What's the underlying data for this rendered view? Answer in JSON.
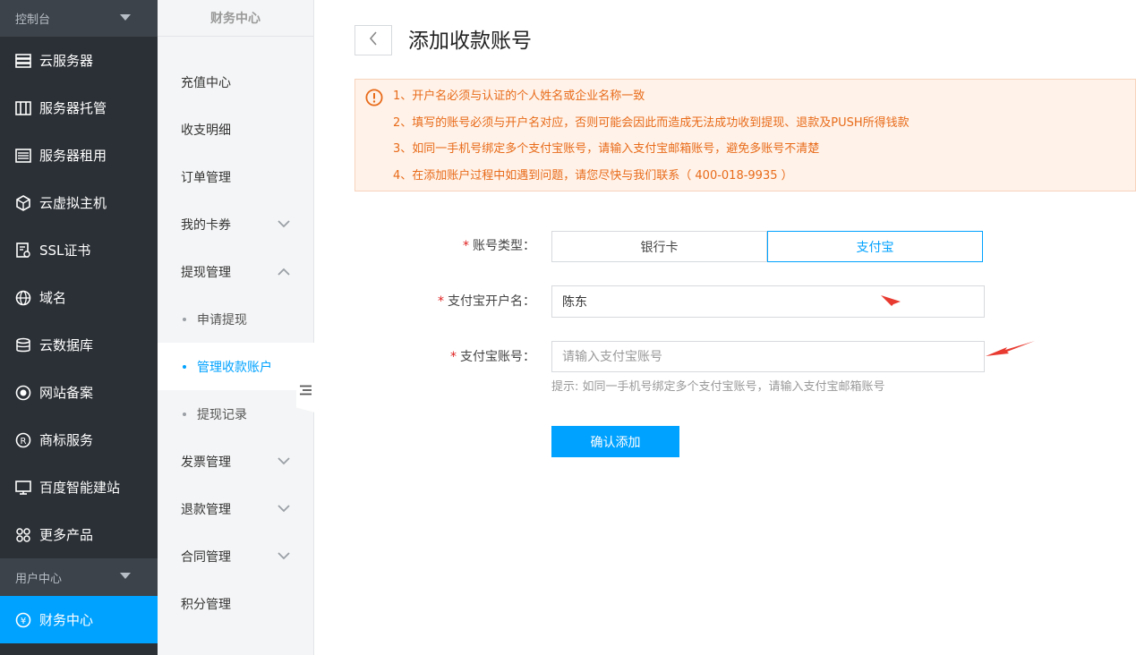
{
  "sidebar": {
    "section_console": "控制台",
    "items": [
      {
        "label": "云服务器",
        "icon": "server-icon"
      },
      {
        "label": "服务器托管",
        "icon": "rack-icon"
      },
      {
        "label": "服务器租用",
        "icon": "list-icon"
      },
      {
        "label": "云虚拟主机",
        "icon": "cube-icon"
      },
      {
        "label": "SSL证书",
        "icon": "certificate-icon"
      },
      {
        "label": "域名",
        "icon": "globe-icon"
      },
      {
        "label": "云数据库",
        "icon": "database-icon"
      },
      {
        "label": "网站备案",
        "icon": "record-icon"
      },
      {
        "label": "商标服务",
        "icon": "trademark-icon"
      },
      {
        "label": "百度智能建站",
        "icon": "monitor-icon"
      },
      {
        "label": "更多产品",
        "icon": "grid-icon"
      }
    ],
    "section_user": "用户中心",
    "active_item": {
      "label": "财务中心",
      "icon": "yen-icon"
    },
    "active_color": "#00a2ff"
  },
  "subnav": {
    "title": "财务中心",
    "items": {
      "recharge": "充值中心",
      "transactions": "收支明细",
      "orders": "订单管理",
      "coupons": "我的卡券",
      "withdraw": "提现管理",
      "withdraw_apply": "申请提现",
      "withdraw_accounts": "管理收款账户",
      "withdraw_records": "提现记录",
      "invoices": "发票管理",
      "refunds": "退款管理",
      "contracts": "合同管理",
      "points": "积分管理"
    }
  },
  "main": {
    "title": "添加收款账号",
    "notice": [
      "1、开户名必须与认证的个人姓名或企业名称一致",
      "2、填写的账号必须与开户名对应，否则可能会因此而造成无法成功收到提现、退款及PUSH所得钱款",
      "3、如同一手机号绑定多个支付宝账号，请输入支付宝邮箱账号，避免多账号不清楚",
      "4、在添加账户过程中如遇到问题，请您尽快与我们联系（ 400-018-9935 ）"
    ],
    "form": {
      "required_mark": "*",
      "type_label": "账号类型：",
      "type_options": {
        "bank": "银行卡",
        "alipay": "支付宝"
      },
      "selected_type": "支付宝",
      "name_label": "支付宝开户名：",
      "name_value": "陈东",
      "account_label": "支付宝账号：",
      "account_placeholder": "请输入支付宝账号",
      "account_value": "",
      "hint": "提示: 如同一手机号绑定多个支付宝账号，请输入支付宝邮箱账号",
      "submit_label": "确认添加"
    },
    "colors": {
      "notice_text": "#e86b1a",
      "annotation_arrow": "#e83a30"
    }
  }
}
